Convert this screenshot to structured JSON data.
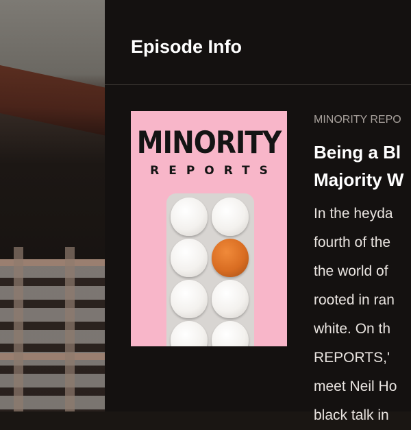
{
  "header": {
    "title": "Episode Info"
  },
  "cover": {
    "title": "MINORITY",
    "subtitle": "REPORTS"
  },
  "episode": {
    "show_name": "MINORITY REPO",
    "title_lines": [
      "Being a Bl",
      "Majority W"
    ],
    "description_lines": [
      "In the heyda",
      "fourth of the",
      "the world of",
      "rooted in ran",
      "white.  On th",
      "REPORTS,'",
      "meet Neil Ho",
      "black talk in"
    ]
  }
}
